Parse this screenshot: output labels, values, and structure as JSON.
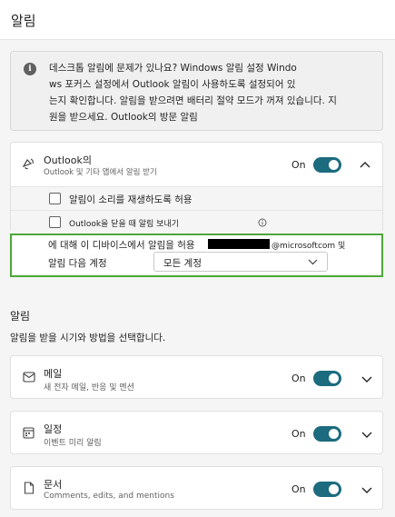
{
  "header": {
    "title": "알림"
  },
  "info": {
    "line1": "데스크톱 알림에 문제가 있나요? Windows 알림 설정 Windo",
    "line2": "ws 포커스 설정에서 Outlook 알림이 사용하도록 설정되어 있",
    "line3": "는지 확인합니다. 알림을 받으려면 배터리 절약 모드가 꺼져 있습니다. 지",
    "line4": "원을 받으세요. Outlook의 방문 알림"
  },
  "outlook": {
    "title": "Outlook의",
    "subtitle": "Outlook 및 기타 앱에서 알림 받기",
    "toggle_label": "On",
    "options": [
      {
        "label": "알림이 소리를 재생하도록 허용"
      },
      {
        "label": "Outlook을 닫을 때 알림 보내기"
      }
    ],
    "device_text": "에 대해 이 디바이스에서 알림을 허용",
    "email_suffix": "@microsoftcom 및",
    "account_label": "알림 다음 계정",
    "account_select": "모든 계정"
  },
  "section": {
    "title": "알림",
    "description": "알림을 받을 시기와 방법을 선택합니다."
  },
  "categories": [
    {
      "title": "메일",
      "subtitle": "새 전자 메일, 반응 및 멘션",
      "toggle_label": "On",
      "icon": "mail-icon"
    },
    {
      "title": "일정",
      "subtitle": "이벤트 미리 알림",
      "toggle_label": "On",
      "icon": "calendar-icon"
    },
    {
      "title": "문서",
      "subtitle": "Comments, edits, and mentions",
      "toggle_label": "On",
      "icon": "document-icon"
    }
  ],
  "colors": {
    "toggle_on": "#1c6b7e",
    "highlight": "#4ca838"
  }
}
